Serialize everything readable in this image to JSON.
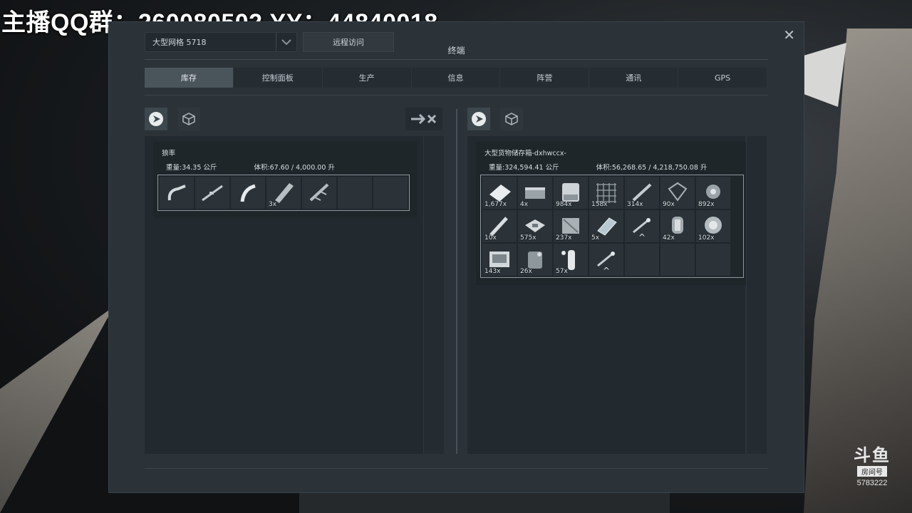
{
  "stream_overlay": {
    "title": "主播QQ群：260080502  YY：44840018",
    "watermark_logo": "斗鱼",
    "watermark_label": "房间号",
    "room_number": "5783222"
  },
  "window": {
    "title": "终端",
    "grid_select": "大型网格 5718",
    "remote_access": "远程访问",
    "tabs": [
      {
        "label": "库存",
        "active": true
      },
      {
        "label": "控制面板",
        "active": false
      },
      {
        "label": "生产",
        "active": false
      },
      {
        "label": "信息",
        "active": false
      },
      {
        "label": "阵营",
        "active": false
      },
      {
        "label": "通讯",
        "active": false
      },
      {
        "label": "GPS",
        "active": false
      }
    ]
  },
  "left_inventory": {
    "name": "狼率",
    "weight": "重量:34.35 公斤",
    "volume": "体积:67.60 / 4,000.00 升",
    "items": [
      {
        "icon": "welder-icon",
        "qty": ""
      },
      {
        "icon": "rifle-icon",
        "qty": ""
      },
      {
        "icon": "grinder-icon",
        "qty": ""
      },
      {
        "icon": "steel-plate-stack-icon",
        "qty": "3x"
      },
      {
        "icon": "drill-icon",
        "qty": ""
      },
      {
        "icon": "empty-slot",
        "qty": ""
      },
      {
        "icon": "empty-slot",
        "qty": ""
      }
    ]
  },
  "right_inventory": {
    "name": "大型货物储存箱-dxhwccx-",
    "weight": "重量:324,594.41 公斤",
    "volume": "体积:56,268.65 / 4,218,750.08 升",
    "items": [
      {
        "icon": "steel-plate-icon",
        "qty": "1,677x"
      },
      {
        "icon": "large-tube-icon",
        "qty": "4x"
      },
      {
        "icon": "construction-comp-icon",
        "qty": "984x"
      },
      {
        "icon": "metal-grid-icon",
        "qty": "158x"
      },
      {
        "icon": "interior-plate-icon",
        "qty": "314x"
      },
      {
        "icon": "girder-icon",
        "qty": "90x"
      },
      {
        "icon": "motor-icon",
        "qty": "892x"
      },
      {
        "icon": "small-tube-icon",
        "qty": "10x"
      },
      {
        "icon": "computer-icon",
        "qty": "575x"
      },
      {
        "icon": "power-cell-icon",
        "qty": "237x"
      },
      {
        "icon": "bulletproof-glass-icon",
        "qty": "5x"
      },
      {
        "icon": "tool-upgrade-icon",
        "qty": ""
      },
      {
        "icon": "thruster-comp-icon",
        "qty": "42x"
      },
      {
        "icon": "reactor-comp-icon",
        "qty": "102x"
      },
      {
        "icon": "display-icon",
        "qty": "143x"
      },
      {
        "icon": "ammo-magazine-icon",
        "qty": "26x"
      },
      {
        "icon": "hydrogen-bottle-icon",
        "qty": "57x"
      },
      {
        "icon": "tool-upgrade-icon",
        "qty": ""
      },
      {
        "icon": "empty-slot",
        "qty": ""
      },
      {
        "icon": "empty-slot",
        "qty": ""
      },
      {
        "icon": "empty-slot",
        "qty": ""
      }
    ]
  }
}
